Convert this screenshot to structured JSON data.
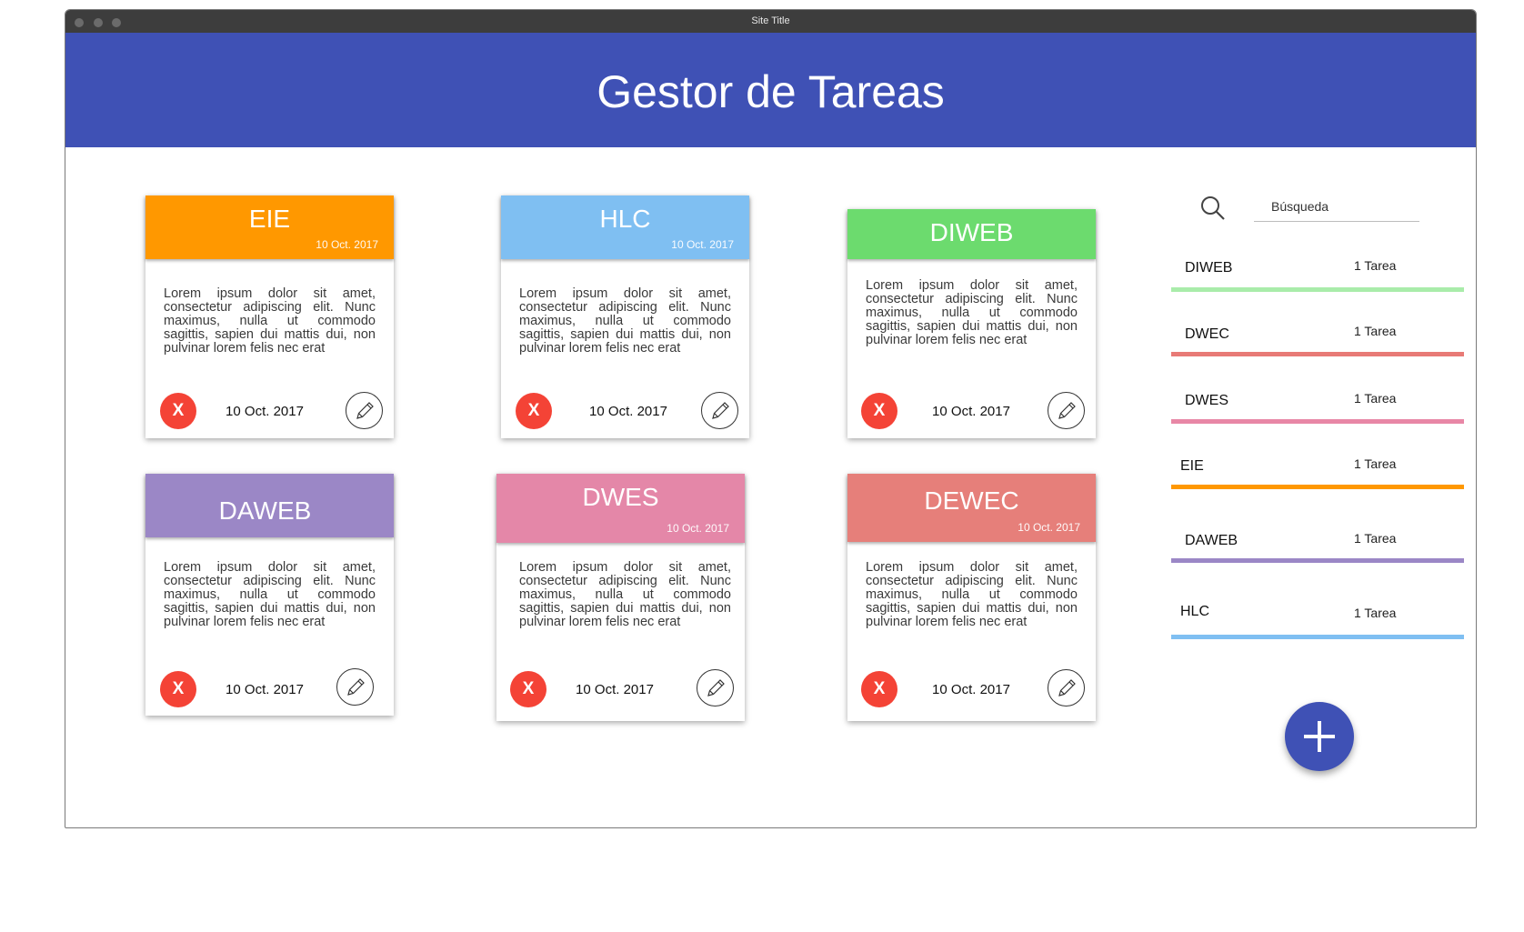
{
  "window": {
    "site_title": "Site Title"
  },
  "header": {
    "title": "Gestor de Tareas"
  },
  "cards": [
    {
      "title": "EIE",
      "header_date": "10 Oct. 2017",
      "body": "Lorem ipsum dolor sit amet, consectetur adipiscing elit. Nunc maximus, nulla ut commodo sagittis, sapien dui mattis dui, non pulvinar lorem felis nec erat",
      "delete_label": "X",
      "footer_date": "10 Oct. 2017",
      "color": "#ff9800"
    },
    {
      "title": "HLC",
      "header_date": "10 Oct. 2017",
      "body": "Lorem ipsum dolor sit amet, consectetur adipiscing elit. Nunc maximus, nulla ut commodo sagittis, sapien dui mattis dui, non pulvinar lorem felis nec erat",
      "delete_label": "X",
      "footer_date": "10 Oct. 2017",
      "color": "#7fbff2"
    },
    {
      "title": "DIWEB",
      "body": "Lorem ipsum dolor sit amet, consectetur adipiscing elit. Nunc maximus, nulla ut commodo sagittis, sapien dui mattis dui, non pulvinar lorem felis nec erat",
      "delete_label": "X",
      "footer_date": "10 Oct. 2017",
      "color": "#6cdb6e"
    },
    {
      "title": "DAWEB",
      "body": "Lorem ipsum dolor sit amet, consectetur adipiscing elit. Nunc maximus, nulla ut commodo sagittis, sapien dui mattis dui, non pulvinar lorem felis nec erat",
      "delete_label": "X",
      "footer_date": "10 Oct. 2017",
      "color": "#9b87c6"
    },
    {
      "title": "DWES",
      "header_date": "10 Oct. 2017",
      "body": "Lorem ipsum dolor sit amet, consectetur adipiscing elit. Nunc maximus, nulla ut commodo sagittis, sapien dui mattis dui, non pulvinar lorem felis nec erat",
      "delete_label": "X",
      "footer_date": "10 Oct. 2017",
      "color": "#e487a8"
    },
    {
      "title": "DEWEC",
      "header_date": "10 Oct. 2017",
      "body": "Lorem ipsum dolor sit amet, consectetur adipiscing elit. Nunc maximus, nulla ut commodo sagittis, sapien dui mattis dui, non pulvinar lorem felis nec erat",
      "delete_label": "X",
      "footer_date": "10 Oct. 2017",
      "color": "#e67f7a"
    }
  ],
  "search": {
    "placeholder": "Búsqueda",
    "icon": "search-icon"
  },
  "task_list": [
    {
      "name": "DIWEB",
      "count": "1 Tarea",
      "color": "#a9ecaa"
    },
    {
      "name": "DWEC",
      "count": "1 Tarea",
      "color": "#e87a76"
    },
    {
      "name": "DWES",
      "count": "1 Tarea",
      "color": "#e887a6"
    },
    {
      "name": "EIE",
      "count": "1 Tarea",
      "color": "#ff9800"
    },
    {
      "name": "DAWEB",
      "count": "1 Tarea",
      "color": "#9b87c6"
    },
    {
      "name": "HLC",
      "count": "1 Tarea",
      "color": "#7fbff2"
    }
  ],
  "fab": {
    "icon": "plus-icon"
  },
  "icons": {
    "delete": "close-icon",
    "edit": "pencil-icon"
  }
}
